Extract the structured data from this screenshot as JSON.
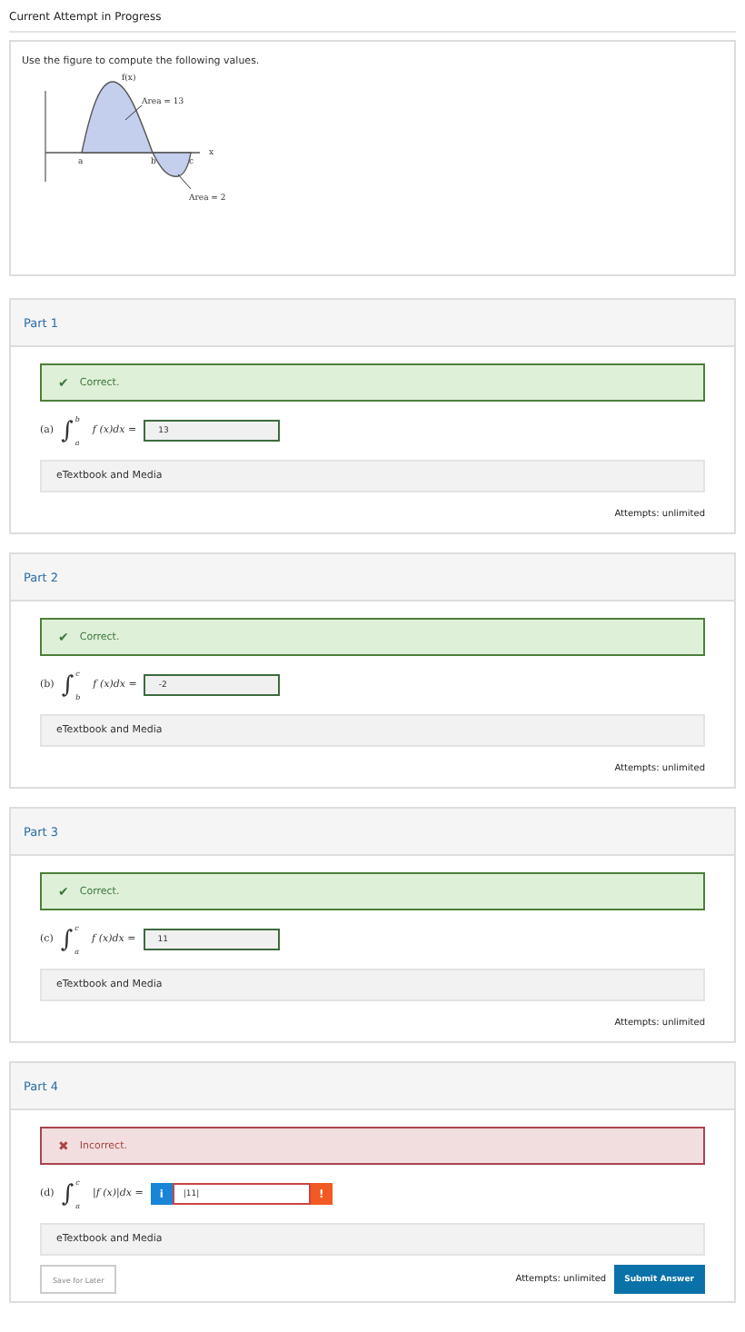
{
  "header": {
    "title": "Current Attempt in Progress"
  },
  "question": {
    "prompt": "Use the figure to compute the following values.",
    "figure": {
      "curve_label": "f(x)",
      "area_top": "Area = 13",
      "area_bottom": "Area = 2",
      "point_a": "a",
      "point_b": "b",
      "point_c": "c",
      "axis_x": "x"
    }
  },
  "parts": [
    {
      "title": "Part 1",
      "feedback": {
        "kind": "correct",
        "mark": "✔",
        "text": "Correct."
      },
      "item": "(a)",
      "sign": "∫",
      "lower": "a",
      "upper": "b",
      "integrand": "f (x)dx =",
      "answer": "13",
      "flagged": false,
      "media": "eTextbook and Media",
      "attempts": "Attempts: unlimited"
    },
    {
      "title": "Part 2",
      "feedback": {
        "kind": "correct",
        "mark": "✔",
        "text": "Correct."
      },
      "item": "(b)",
      "sign": "∫",
      "lower": "b",
      "upper": "c",
      "integrand": "f (x)dx =",
      "answer": "-2",
      "flagged": false,
      "media": "eTextbook and Media",
      "attempts": "Attempts: unlimited"
    },
    {
      "title": "Part 3",
      "feedback": {
        "kind": "correct",
        "mark": "✔",
        "text": "Correct."
      },
      "item": "(c)",
      "sign": "∫",
      "lower": "a",
      "upper": "c",
      "integrand": "f (x)dx =",
      "answer": "11",
      "flagged": false,
      "media": "eTextbook and Media",
      "attempts": "Attempts: unlimited"
    },
    {
      "title": "Part 4",
      "feedback": {
        "kind": "incorrect",
        "mark": "✖",
        "text": "Incorrect."
      },
      "item": "(d)",
      "sign": "∫",
      "lower": "a",
      "upper": "c",
      "integrand": "|f (x)|dx =",
      "answer": "|11|",
      "flagged": true,
      "info": "i",
      "alert": "!",
      "media": "eTextbook and Media",
      "attempts": "Attempts: unlimited",
      "save": "Save for Later",
      "submit": "Submit Answer"
    }
  ]
}
